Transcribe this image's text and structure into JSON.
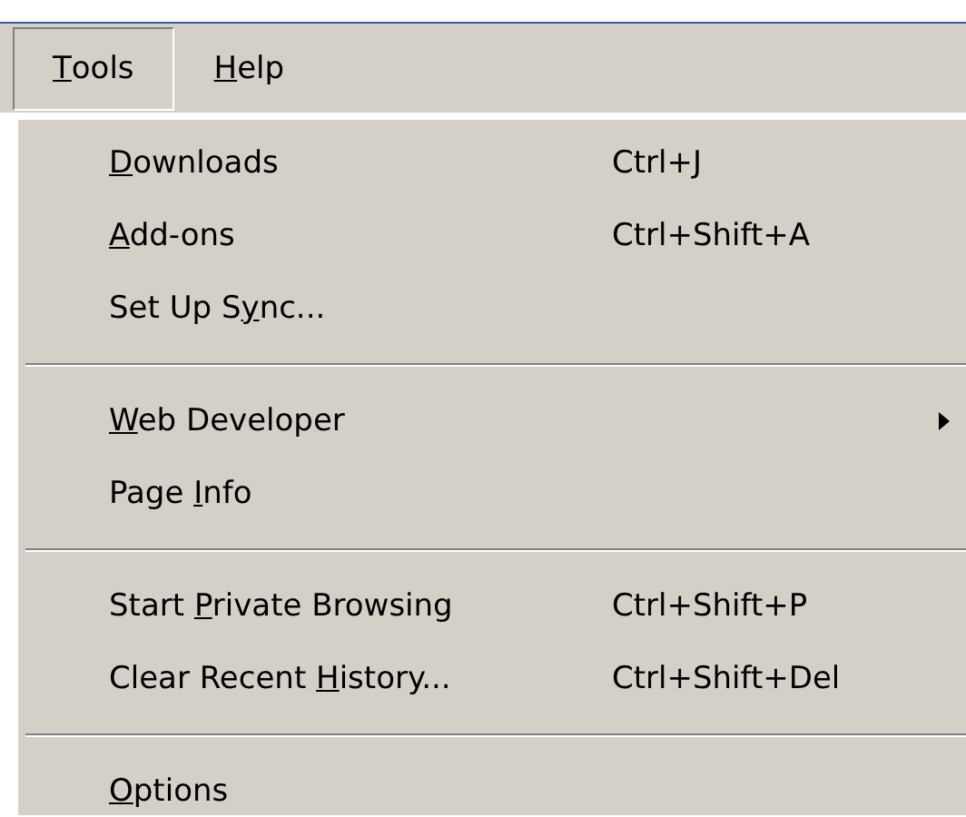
{
  "menubar": [
    {
      "key": "T",
      "post": "ools",
      "selected": true
    },
    {
      "key": "H",
      "post": "elp",
      "selected": false
    }
  ],
  "menu": {
    "sections": [
      {
        "items": [
          {
            "key": "D",
            "post": "ownloads",
            "shortcut": "Ctrl+J",
            "has_submenu": false
          },
          {
            "key": "A",
            "post": "dd-ons",
            "shortcut": "Ctrl+Shift+A",
            "has_submenu": false
          },
          {
            "pre": "Set Up S",
            "key": "y",
            "post": "nc...",
            "has_submenu": false
          }
        ]
      },
      {
        "items": [
          {
            "key": "W",
            "post": "eb Developer",
            "has_submenu": true
          },
          {
            "pre": "Page ",
            "key": "I",
            "post": "nfo",
            "has_submenu": false
          }
        ]
      },
      {
        "items": [
          {
            "pre": "Start ",
            "key": "P",
            "post": "rivate Browsing",
            "shortcut": "Ctrl+Shift+P",
            "has_submenu": false
          },
          {
            "pre": "Clear Recent ",
            "key": "H",
            "post": "istory...",
            "shortcut": "Ctrl+Shift+Del",
            "has_submenu": false
          }
        ]
      },
      {
        "items": [
          {
            "key": "O",
            "post": "ptions",
            "has_submenu": false
          }
        ]
      }
    ]
  }
}
